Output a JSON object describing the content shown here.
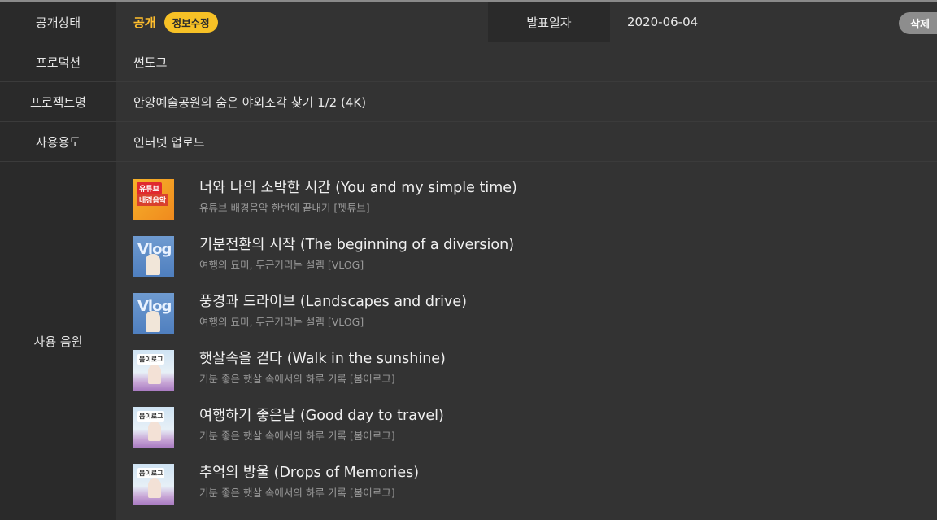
{
  "fields": {
    "status_label": "공개상태",
    "status_value": "공개",
    "edit_button": "정보수정",
    "publish_date_label": "발표일자",
    "publish_date": "2020-06-04",
    "delete_button": "삭제",
    "production_label": "프로덕션",
    "production_value": "썬도그",
    "project_label": "프로젝트명",
    "project_value": "안양예술공원의 숨은 야외조각 찾기 1/2 (4K)",
    "usage_label": "사용용도",
    "usage_value": "인터넷 업로드",
    "music_label": "사용 음원"
  },
  "tracks": [
    {
      "title": "너와 나의 소박한 시간 (You and my simple time)",
      "album": "유튜브 배경음악 한번에 끝내기 [펫튜브]",
      "thumb_text": "유튜브",
      "thumb_text2": "배경음악",
      "thumb_icon": "youtube-bgm-cover"
    },
    {
      "title": "기분전환의 시작 (The beginning of a diversion)",
      "album": "여행의 묘미, 두근거리는 설렘 [VLOG]",
      "thumb_text": "Vlog",
      "thumb_icon": "vlog-cover"
    },
    {
      "title": "풍경과 드라이브 (Landscapes and drive)",
      "album": "여행의 묘미, 두근거리는 설렘 [VLOG]",
      "thumb_text": "Vlog",
      "thumb_icon": "vlog-cover"
    },
    {
      "title": "햇살속을 걷다 (Walk in the sunshine)",
      "album": "기분 좋은 햇살 속에서의 하루 기록 [봄이로그]",
      "thumb_text": "봄이로그",
      "thumb_icon": "bomilog-cover"
    },
    {
      "title": "여행하기 좋은날 (Good day to travel)",
      "album": "기분 좋은 햇살 속에서의 하루 기록 [봄이로그]",
      "thumb_text": "봄이로그",
      "thumb_icon": "bomilog-cover"
    },
    {
      "title": "추억의 방울 (Drops of Memories)",
      "album": "기분 좋은 햇살 속에서의 하루 기록 [봄이로그]",
      "thumb_text": "봄이로그",
      "thumb_icon": "bomilog-cover"
    }
  ],
  "colors": {
    "accent_yellow": "#f7c126",
    "status_orange": "#ffbe2e",
    "background": "#2f2f2f"
  }
}
